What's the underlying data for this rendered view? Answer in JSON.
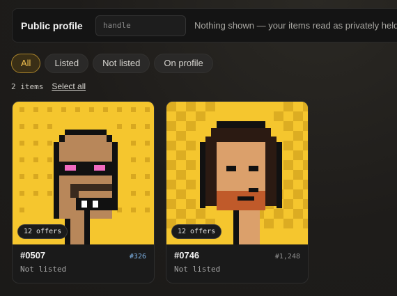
{
  "profile": {
    "label": "Public profile",
    "handle_placeholder": "handle",
    "hint": "Nothing shown — your items read as privately held"
  },
  "filters": [
    {
      "label": "All",
      "active": true
    },
    {
      "label": "Listed",
      "active": false
    },
    {
      "label": "Not listed",
      "active": false
    },
    {
      "label": "On profile",
      "active": false
    }
  ],
  "summary": {
    "count": "2 items",
    "select_all": "Select all"
  },
  "items": [
    {
      "offers": "12 offers",
      "title": "#0507",
      "rank": "#326",
      "rank_color": "#7fb3e6",
      "status": "Not listed",
      "bg_color": "#f5c62e"
    },
    {
      "offers": "12 offers",
      "title": "#0746",
      "rank": "#1,248",
      "rank_color": "#8f8f8f",
      "status": "Not listed",
      "bg_color": "#f5c62e"
    }
  ],
  "colors": {
    "accent": "#f2c14f",
    "background": "#1e1c1a"
  }
}
